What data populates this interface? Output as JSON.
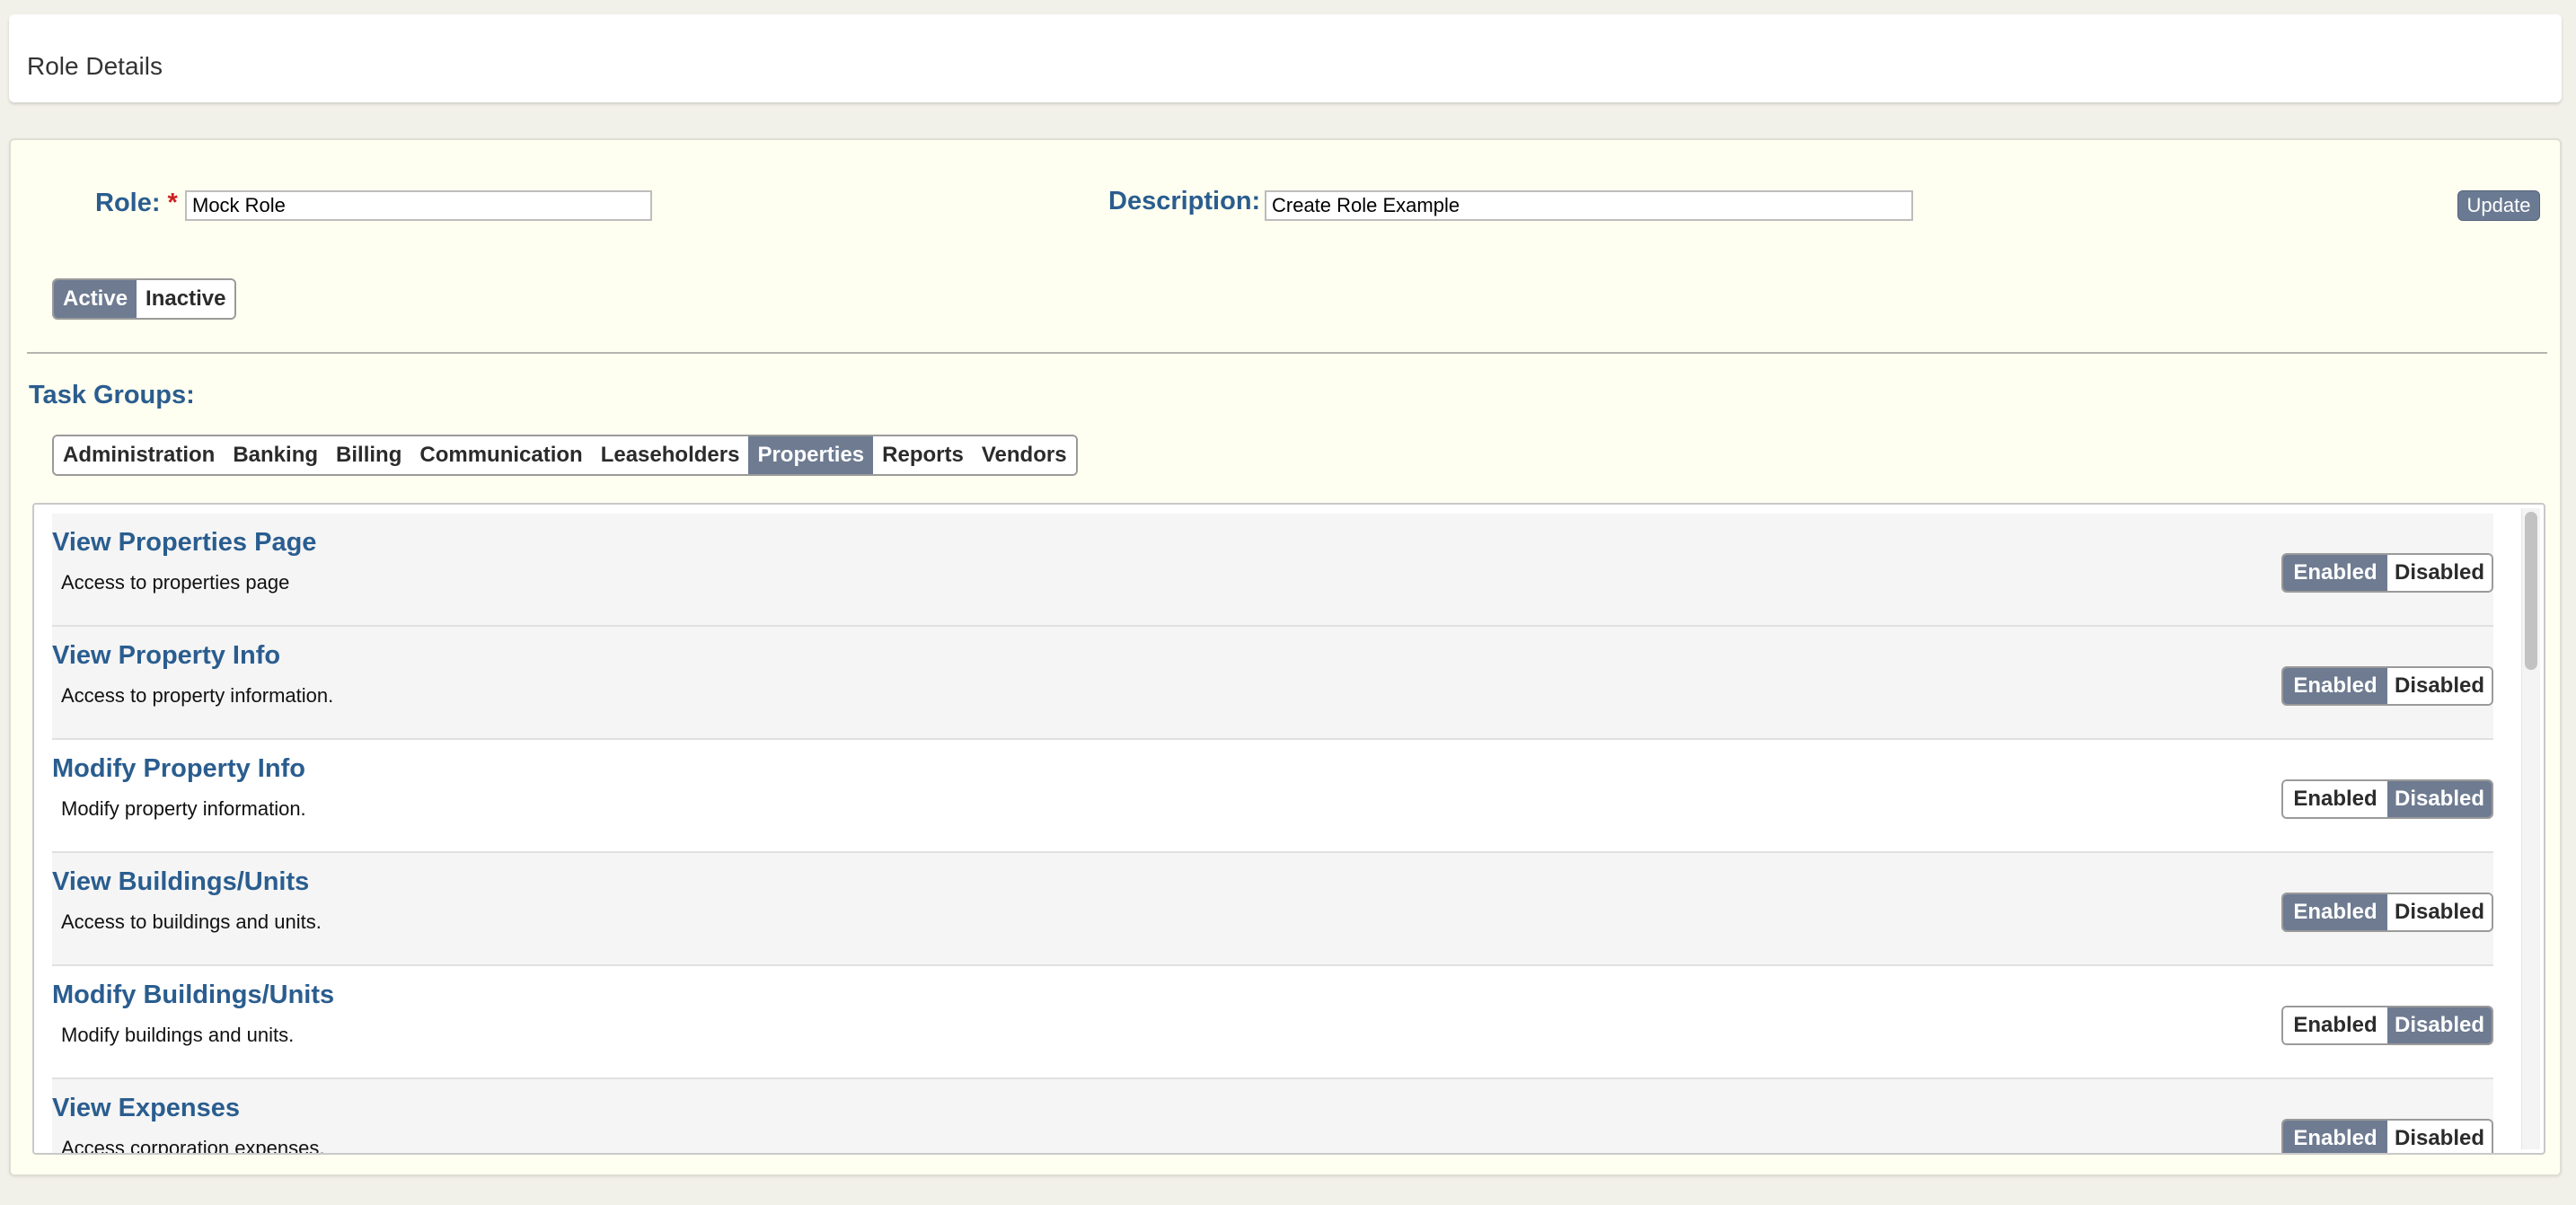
{
  "header": {
    "title": "Role Details"
  },
  "form": {
    "role_label": "Role:",
    "required_marker": "*",
    "role_value": "Mock Role",
    "description_label": "Description:",
    "description_value": "Create Role Example",
    "update_label": "Update"
  },
  "status_toggle": {
    "active_label": "Active",
    "inactive_label": "Inactive",
    "selected": "Active"
  },
  "task_groups": {
    "label": "Task Groups:",
    "tabs": [
      "Administration",
      "Banking",
      "Billing",
      "Communication",
      "Leaseholders",
      "Properties",
      "Reports",
      "Vendors"
    ],
    "selected_tab": "Properties"
  },
  "tasks": [
    {
      "title": "View Properties Page",
      "description": "Access to properties page",
      "enabled": true
    },
    {
      "title": "View Property Info",
      "description": "Access to property information.",
      "enabled": true
    },
    {
      "title": "Modify Property Info",
      "description": "Modify property information.",
      "enabled": false
    },
    {
      "title": "View Buildings/Units",
      "description": "Access to buildings and units.",
      "enabled": true
    },
    {
      "title": "Modify Buildings/Units",
      "description": "Modify buildings and units.",
      "enabled": false
    },
    {
      "title": "View Expenses",
      "description": "Access corporation expenses.",
      "enabled": true
    }
  ],
  "toggle_labels": {
    "enabled": "Enabled",
    "disabled": "Disabled"
  },
  "colors": {
    "accent_blue": "#2a5d8f",
    "selected_segment": "#6e7b91",
    "panel_background": "#fefff0",
    "required_red": "#cc1f1f"
  }
}
